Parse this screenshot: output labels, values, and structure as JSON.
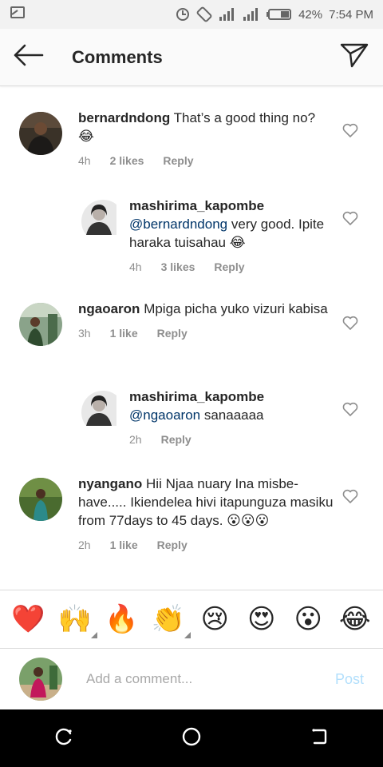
{
  "status_bar": {
    "battery_percent": "42%",
    "time": "7:54 PM"
  },
  "header": {
    "title": "Comments"
  },
  "comments": [
    {
      "username": "bernardndong",
      "mention": "",
      "text": "That’s a good thing no? 😂",
      "time": "4h",
      "likes": "2 likes",
      "reply": "Reply"
    },
    {
      "username": "mashirima_kapombe",
      "mention": "@bernardndong",
      "text": " very good. Ipite haraka tuisahau 😂",
      "time": "4h",
      "likes": "3 likes",
      "reply": "Reply"
    },
    {
      "username": "ngaoaron",
      "mention": "",
      "text": "Mpiga picha yuko vizuri kabisa",
      "time": "3h",
      "likes": "1 like",
      "reply": "Reply"
    },
    {
      "username": "mashirima_kapombe",
      "mention": "@ngaoaron",
      "text": " sanaaaaa",
      "time": "2h",
      "likes": "",
      "reply": "Reply"
    },
    {
      "username": "nyangano",
      "mention": "",
      "text": "Hii Njaa nuary Ina misbe-have..... Ikiendelea hivi itapunguza masiku from 77days to 45 days. 😮😮😮",
      "time": "2h",
      "likes": "1 like",
      "reply": "Reply"
    }
  ],
  "emoji_bar": [
    {
      "glyph": "❤️",
      "name": "red-heart"
    },
    {
      "glyph": "🙌",
      "name": "raising-hands"
    },
    {
      "glyph": "🔥",
      "name": "fire"
    },
    {
      "glyph": "👏",
      "name": "clapping-hands"
    },
    {
      "glyph": "😢",
      "name": "crying-face"
    },
    {
      "glyph": "😍",
      "name": "heart-eyes"
    },
    {
      "glyph": "😮",
      "name": "surprised-face"
    },
    {
      "glyph": "😂",
      "name": "tears-of-joy"
    }
  ],
  "add_comment": {
    "placeholder": "Add a comment...",
    "post_label": "Post"
  },
  "colors": {
    "header_bg": "#fafafa",
    "mention": "#003569",
    "post_disabled": "#b2dffc",
    "heart_outline": "#8e8e8e"
  }
}
